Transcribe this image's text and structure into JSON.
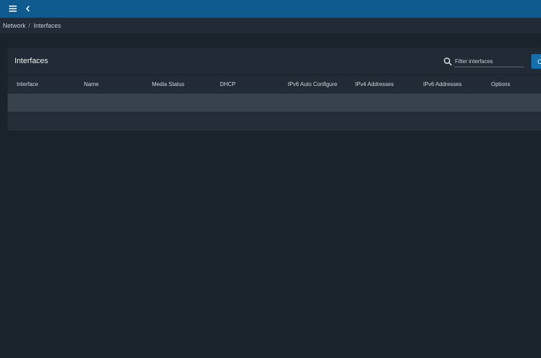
{
  "topbar": {
    "menu_icon": "hamburger-menu-icon",
    "back_icon": "chevron-left-icon",
    "color": "#0f5a8f"
  },
  "breadcrumbs": {
    "items": [
      "Network",
      "Interfaces"
    ],
    "separator": "/"
  },
  "card": {
    "title": "Interfaces",
    "filter_placeholder": "Filter interfaces",
    "filter_value": "",
    "primary_button_label": "C"
  },
  "table": {
    "columns": [
      "Interface",
      "Name",
      "Media Status",
      "DHCP",
      "IPv6 Auto Configure",
      "IPv4 Addresses",
      "IPv6 Addresses",
      "Options"
    ],
    "rows": []
  },
  "colors": {
    "background": "#1a222b",
    "card": "#222b35",
    "accent": "#1370ad"
  }
}
